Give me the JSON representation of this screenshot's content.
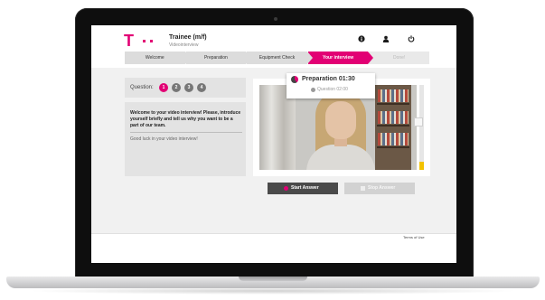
{
  "app": {
    "brand_color": "#e20074",
    "job_title": "Trainee (m/f)",
    "job_subtitle": "Videointerview"
  },
  "header": {
    "icons": [
      "info-icon",
      "user-icon",
      "power-icon"
    ]
  },
  "steps": [
    {
      "label": "Welcome",
      "state": "done"
    },
    {
      "label": "Preparation",
      "state": "done"
    },
    {
      "label": "Equipment Check",
      "state": "done"
    },
    {
      "label": "Your interview",
      "state": "active"
    },
    {
      "label": "Done!",
      "state": "future"
    }
  ],
  "questions": {
    "label": "Question:",
    "numbers": [
      "1",
      "2",
      "3",
      "4"
    ],
    "active_index": 0
  },
  "message": {
    "intro": "Welcome to your video interview! Please, introduce yourself briefly and tell us why you want to be a part of our team.",
    "good_luck": "Good luck in your video interview!"
  },
  "timers": {
    "preparation": "Preparation 01:30",
    "question": "Question 02:00"
  },
  "audio_level": 0.1,
  "buttons": {
    "start": "Start Answer",
    "stop": "Stop Answer"
  },
  "footer": {
    "terms": "Terms of Use"
  }
}
